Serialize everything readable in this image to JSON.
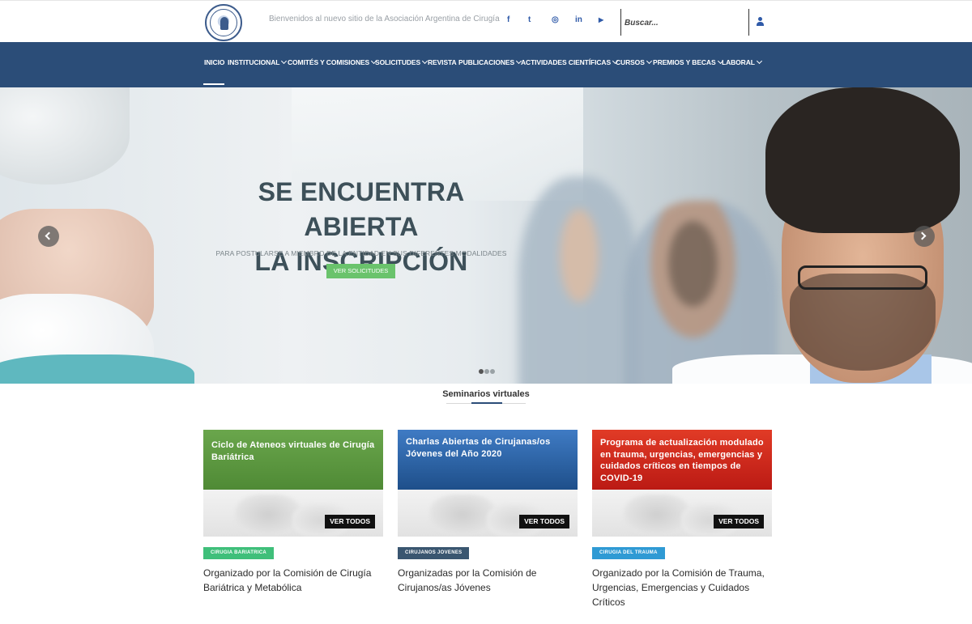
{
  "header": {
    "welcome": "Bienvenidos al nuevo sitio de la Asociación Argentina de Cirugía",
    "social": [
      {
        "name": "facebook",
        "glyph": "f"
      },
      {
        "name": "twitter",
        "glyph": "t"
      },
      {
        "name": "instagram",
        "glyph": "◎"
      },
      {
        "name": "linkedin",
        "glyph": "in"
      },
      {
        "name": "youtube",
        "glyph": "▶"
      }
    ],
    "search_placeholder": "Buscar..."
  },
  "nav": {
    "items": [
      {
        "label": "INICIO",
        "dropdown": false
      },
      {
        "label": "INSTITUCIONAL",
        "dropdown": true
      },
      {
        "label": "COMITÉS Y COMISIONES",
        "dropdown": true
      },
      {
        "label": "SOLICITUDES",
        "dropdown": true
      },
      {
        "label": "REVISTA",
        "dropdown": false
      },
      {
        "label": "PUBLICACIONES",
        "dropdown": true
      },
      {
        "label": "ACTIVIDADES CIENTÍFICAS",
        "dropdown": true
      },
      {
        "label": "CURSOS",
        "dropdown": true
      },
      {
        "label": "PREMIOS Y BECAS",
        "dropdown": true
      },
      {
        "label": "LABORAL",
        "dropdown": true
      }
    ]
  },
  "hero": {
    "title_line1": "SE ENCUENTRA ABIERTA",
    "title_line2": "LA INSCRIPCIÓN",
    "subtitle": "PARA POSTULARSE A MIEMBRO DE LA ENTIDAD EN SUS DIFERENTES MODALIDADES",
    "button": "VER SOLICITUDES",
    "slides": 3,
    "active_slide": 1
  },
  "section": {
    "title": "Seminarios virtuales"
  },
  "cards": [
    {
      "title": "Ciclo de Ateneos virtuales de Cirugía Bariátrica",
      "button": "VER TODOS",
      "tag": "CIRUGIA BARIATRICA",
      "description": "Organizado por la Comisión de Cirugía Bariátrica y Metabólica",
      "color": "#5a9a40",
      "tag_color": "#3fbf7a"
    },
    {
      "title": "Charlas Abiertas de Cirujanas/os Jóvenes del Año 2020",
      "button": "VER TODOS",
      "tag": "CIRUJANOS JOVENES",
      "description": "Organizadas por la Comisión de Cirujanos/as Jóvenes",
      "color": "#2e65a8",
      "tag_color": "#3a5670"
    },
    {
      "title": "Programa de actualización modulado en trauma, urgencias, emergencias y cuidados críticos en tiempos de COVID-19",
      "button": "VER TODOS",
      "tag": "CIRUGIA DEL TRAUMA",
      "description": "Organizado por la Comisión de Trauma, Urgencias, Emergencias y Cuidados Críticos",
      "color": "#d02a1d",
      "tag_color": "#2f9ad4"
    }
  ],
  "colors": {
    "nav_bg": "#2b4d78",
    "accent_green": "#6ac36c",
    "hero_title": "#3d5059"
  }
}
